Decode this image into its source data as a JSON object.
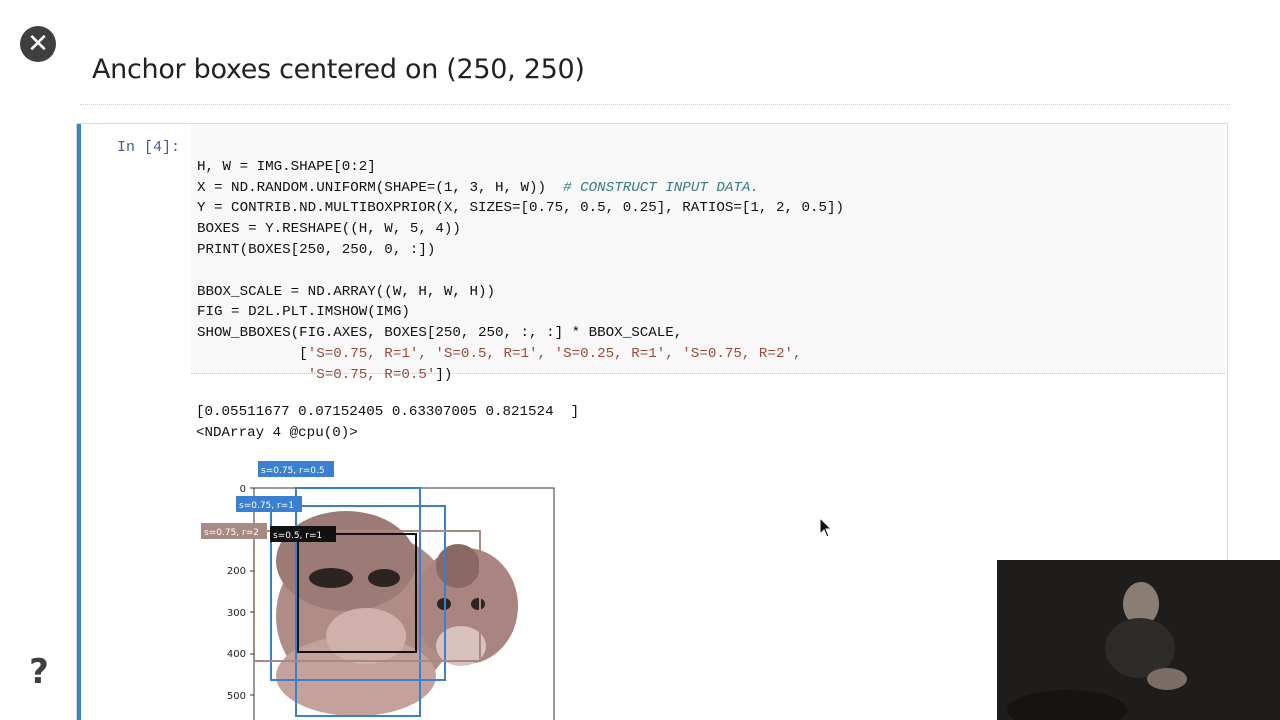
{
  "slide": {
    "title": "Anchor boxes centered on (250, 250)"
  },
  "controls": {
    "close_icon": "close-icon",
    "help_label": "?"
  },
  "cell": {
    "prompt": "In [4]:",
    "code": {
      "line1": "H, W = IMG.SHAPE[0:2]",
      "line2_code": "X = ND.RANDOM.UNIFORM(SHAPE=(1, 3, H, W))  ",
      "line2_comment": "# CONSTRUCT INPUT DATA.",
      "line3": "Y = CONTRIB.ND.MULTIBOXPRIOR(X, SIZES=[0.75, 0.5, 0.25], RATIOS=[1, 2, 0.5])",
      "line4": "BOXES = Y.RESHAPE((H, W, 5, 4))",
      "line5": "PRINT(BOXES[250, 250, 0, :])",
      "line6": "",
      "line7": "BBOX_SCALE = ND.ARRAY((W, H, W, H))",
      "line8": "FIG = D2L.PLT.IMSHOW(IMG)",
      "line9": "SHOW_BBOXES(FIG.AXES, BOXES[250, 250, :, :] * BBOX_SCALE,",
      "line10_prefix": "            [",
      "line10_strings": "'S=0.75, R=1', 'S=0.5, R=1', 'S=0.25, R=1', 'S=0.75, R=2',",
      "line11_prefix": "             ",
      "line11_strings": "'S=0.75, R=0.5'",
      "line11_suffix": "])"
    },
    "output": {
      "line1": "[0.05511677 0.07152405 0.63307005 0.821524  ]",
      "line2": "<NDArray 4 @cpu(0)>"
    }
  },
  "plot": {
    "y_ticks": [
      "0",
      "200",
      "300",
      "400",
      "500"
    ],
    "box_labels": [
      "s=0.75, r=0.5",
      "s=0.75, r=1",
      "s=0.5, r=1",
      "s=0.75, r=2"
    ],
    "colors": {
      "blue": "#3b7fd0",
      "brown": "#a88a85",
      "black": "#111111",
      "accent_bar": "#3c83c4"
    }
  }
}
